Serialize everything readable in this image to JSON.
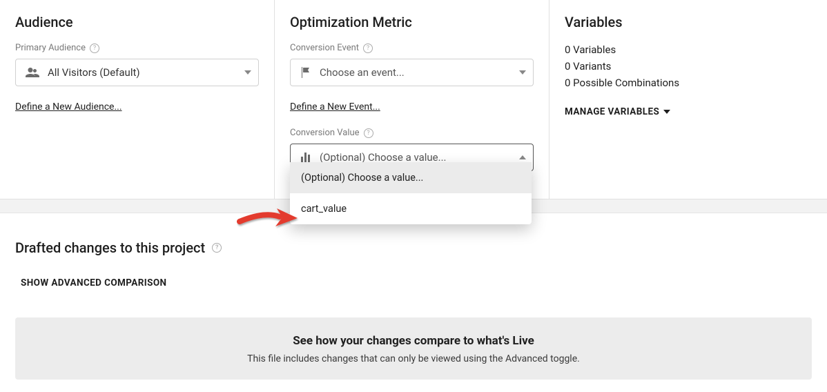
{
  "audience": {
    "title": "Audience",
    "primary_label": "Primary Audience",
    "selected": "All Visitors (Default)",
    "define_link": "Define a New Audience..."
  },
  "metric": {
    "title": "Optimization Metric",
    "event_label": "Conversion Event",
    "event_placeholder": "Choose an event...",
    "define_link": "Define a New Event...",
    "value_label": "Conversion Value",
    "value_placeholder": "(Optional) Choose a value...",
    "dropdown": {
      "option_placeholder": "(Optional) Choose a value...",
      "option_1": "cart_value"
    }
  },
  "variables": {
    "title": "Variables",
    "line_vars": "0 Variables",
    "line_variants": "0 Variants",
    "line_combos": "0 Possible Combinations",
    "manage_label": "MANAGE VARIABLES"
  },
  "drafts": {
    "title": "Drafted changes to this project",
    "advanced_label": "SHOW ADVANCED COMPARISON",
    "banner_title": "See how your changes compare to what's Live",
    "banner_sub": "This file includes changes that can only be viewed using the Advanced toggle."
  }
}
